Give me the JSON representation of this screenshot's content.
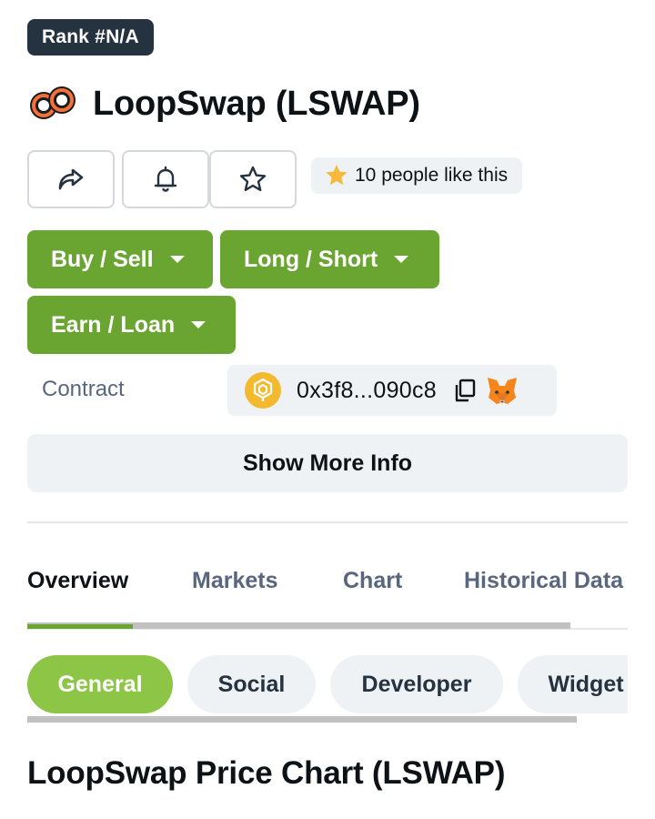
{
  "header": {
    "rank_badge": "Rank #N/A",
    "coin_title": "LoopSwap (LSWAP)"
  },
  "actions": {
    "share_icon": "share-icon",
    "alert_icon": "bell-icon",
    "watchlist_icon": "star-outline-icon",
    "likes_text": "10 people like this"
  },
  "trade_buttons": {
    "buy_sell": "Buy / Sell",
    "long_short": "Long / Short",
    "earn_loan": "Earn / Loan"
  },
  "contract": {
    "label": "Contract",
    "chain_icon": "bnb-chain-icon",
    "address": "0x3f8...090c8",
    "copy_icon": "copy-icon",
    "wallet_icon": "metamask-fox-icon"
  },
  "show_more_label": "Show More Info",
  "tabs": [
    "Overview",
    "Markets",
    "Chart",
    "Historical Data"
  ],
  "active_tab": "Overview",
  "sub_tabs": [
    "General",
    "Social",
    "Developer",
    "Widget"
  ],
  "active_sub_tab": "General",
  "section_title": "LoopSwap Price Chart (LSWAP)",
  "colors": {
    "accent_green": "#6aa532",
    "chip_active": "#8dc647",
    "badge_dark": "#253240",
    "muted_text": "#58667e",
    "pill_bg": "#eff2f5"
  }
}
